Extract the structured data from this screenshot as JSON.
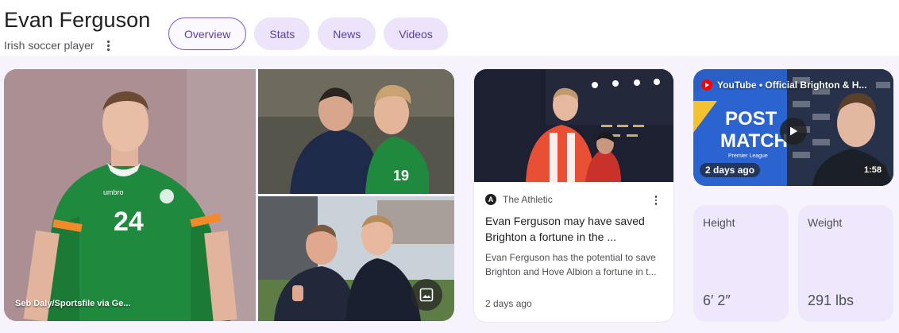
{
  "entity": {
    "name": "Evan Ferguson",
    "description": "Irish soccer player"
  },
  "tabs": [
    {
      "label": "Overview",
      "active": true
    },
    {
      "label": "Stats",
      "active": false
    },
    {
      "label": "News",
      "active": false
    },
    {
      "label": "Videos",
      "active": false
    }
  ],
  "images": {
    "main_caption": "Seb Daly/Sportsfile via Ge...",
    "shirt_number": "24",
    "shirt_number_2": "19"
  },
  "news": {
    "source": "The Athletic",
    "source_initial": "A",
    "title": "Evan Ferguson may have saved Brighton a fortune in the ...",
    "snippet": "Evan Ferguson has the potential to save Brighton and Hove Albion a fortune in t...",
    "time": "2 days ago"
  },
  "video": {
    "channel": "YouTube • Official Brighton & H...",
    "thumb_text_line1": "POST",
    "thumb_text_line2": "MATCH",
    "thumb_text_line3": "Premier League",
    "age": "2 days ago",
    "duration": "1:58"
  },
  "stats": [
    {
      "label": "Height",
      "value": "6′ 2″"
    },
    {
      "label": "Weight",
      "value": "291 lbs"
    }
  ],
  "colors": {
    "accent": "#5b3ea6",
    "tab_bg": "#ede4fb",
    "stat_bg": "#efe7fb",
    "irish_green": "#1f8a3e",
    "brighton_blue": "#2b63cf",
    "youtube_red": "#ff0000"
  }
}
